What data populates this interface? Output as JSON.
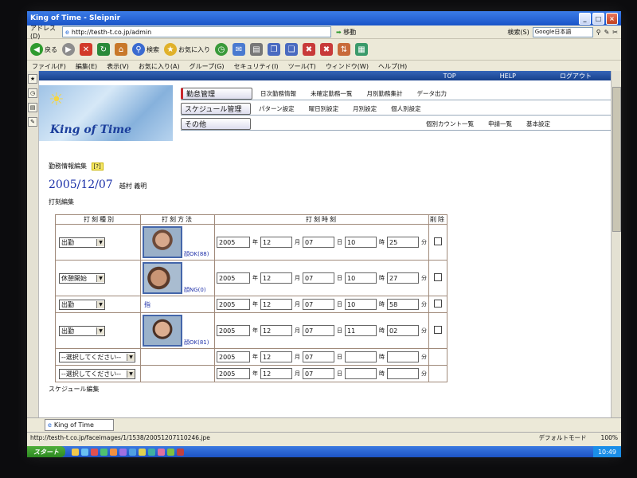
{
  "window": {
    "title": "King of Time - Sleipnir"
  },
  "address": {
    "label": "アドレス(D)",
    "url": "http://testh-t.co.jp/admin",
    "go": "移動",
    "search_label": "検索(S)",
    "search_engine": "Google日本語"
  },
  "toolbar": {
    "back": "戻る",
    "search": "検索",
    "favorites": "お気に入り"
  },
  "menu": [
    "ファイル(F)",
    "編集(E)",
    "表示(V)",
    "お気に入り(A)",
    "グループ(G)",
    "セキュリティ(I)",
    "ツール(T)",
    "ウィンドウ(W)",
    "ヘルプ(H)"
  ],
  "topnav": [
    "TOP",
    "HELP",
    "ログアウト"
  ],
  "logo": {
    "text": "King of Time"
  },
  "nav": {
    "row1": {
      "main": "勤怠管理",
      "subs": [
        "日次勤務情報",
        "未確定勤務一覧",
        "月別勤務集計",
        "データ出力"
      ]
    },
    "row2": {
      "main": "スケジュール管理",
      "subs": [
        "パターン設定",
        "曜日別設定",
        "月別設定",
        "個人別設定"
      ]
    },
    "row3": {
      "main": "その他",
      "subs": [
        "個別カウント一覧",
        "申請一覧",
        "基本設定"
      ]
    }
  },
  "section": {
    "title": "勤務情報編集",
    "help": "[?]"
  },
  "date": "2005/12/07",
  "person": "越村 義明",
  "sub_section": "打刻編集",
  "table": {
    "headers": [
      "打刻種別",
      "打刻方法",
      "打刻時刻",
      "削除"
    ],
    "units": {
      "year": "年",
      "month": "月",
      "day": "日",
      "hour": "時",
      "minute": "分"
    },
    "rows": [
      {
        "type": "出勤",
        "method": "顔OK(88)",
        "year": "2005",
        "month": "12",
        "day": "07",
        "hour": "10",
        "minute": "25"
      },
      {
        "type": "休憩開始",
        "method": "顔NG(0)",
        "year": "2005",
        "month": "12",
        "day": "07",
        "hour": "10",
        "minute": "27"
      },
      {
        "type": "出勤",
        "method": "指",
        "year": "2005",
        "month": "12",
        "day": "07",
        "hour": "10",
        "minute": "58"
      },
      {
        "type": "出勤",
        "method": "顔OK(81)",
        "year": "2005",
        "month": "12",
        "day": "07",
        "hour": "11",
        "minute": "02"
      },
      {
        "type": "--選択してください--",
        "method": "",
        "year": "2005",
        "month": "12",
        "day": "07",
        "hour": "",
        "minute": ""
      },
      {
        "type": "--選択してください--",
        "method": "",
        "year": "2005",
        "month": "12",
        "day": "07",
        "hour": "",
        "minute": ""
      }
    ]
  },
  "schedule_section": "スケジュール編集",
  "tab": {
    "label": "King of Time"
  },
  "status": {
    "url": "http://testh-t.co.jp/faceimages/1/1538/20051207110246.jpe",
    "mode": "デフォルトモード",
    "zoom": "100%"
  },
  "taskbar": {
    "start": "スタート",
    "clock": "10:49"
  }
}
